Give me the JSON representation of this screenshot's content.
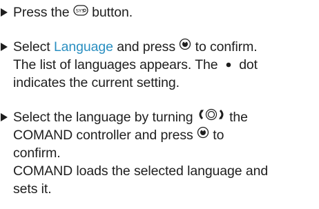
{
  "steps": [
    {
      "text_before": "Press the",
      "button_icon": "sys-button-icon",
      "text_after": "button."
    },
    {
      "text_before": "Select",
      "menu_item": "Language",
      "text_middle": "and press",
      "confirm_icon": "press-controller-icon",
      "text_after": "to confirm.",
      "result_line1_before": "The list of languages appears. The",
      "dot_icon": "bullet-dot-icon",
      "result_line1_after": "dot",
      "result_line2": "indicates the current setting."
    },
    {
      "line1_before": "Select the language by turning",
      "turn_icon": "turn-controller-icon",
      "line1_after": "the",
      "line2_before": "COMAND controller and press",
      "confirm_icon": "press-controller-icon",
      "line2_after": "to",
      "line3": "confirm.",
      "result_line1": "COMAND loads the selected language and",
      "result_line2": "sets it."
    }
  ]
}
